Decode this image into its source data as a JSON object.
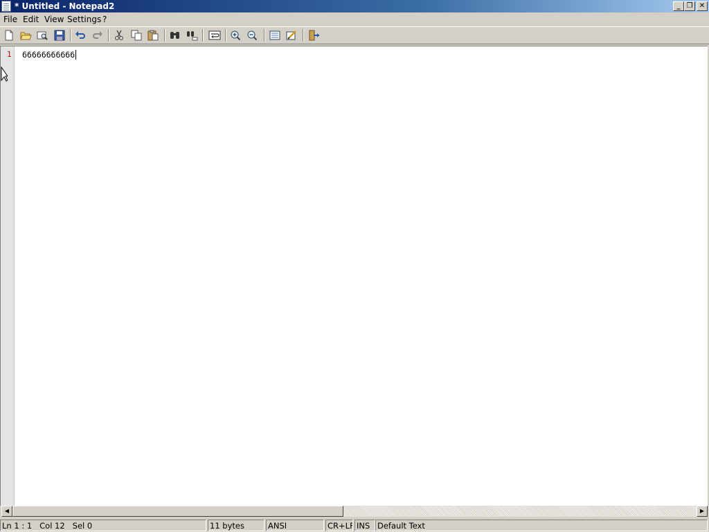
{
  "window": {
    "title": "* Untitled - Notepad2",
    "minimize_glyph": "_",
    "restore_glyph": "❐",
    "close_glyph": "✕"
  },
  "menu": {
    "items": [
      "File",
      "Edit",
      "View",
      "Settings",
      "?"
    ]
  },
  "toolbar": {
    "buttons": [
      "new-icon",
      "open-icon",
      "browse-icon",
      "save-icon",
      "undo-icon",
      "redo-icon",
      "cut-icon",
      "copy-icon",
      "paste-icon",
      "find-icon",
      "replace-icon",
      "word-wrap-icon",
      "zoom-in-icon",
      "zoom-out-icon",
      "select-scheme-icon",
      "customize-scheme-icon",
      "exit-icon"
    ]
  },
  "editor": {
    "lines": [
      {
        "number": "1",
        "text": "66666666666"
      }
    ]
  },
  "scrollbar": {
    "left_arrow": "◀",
    "right_arrow": "▶"
  },
  "status": {
    "position": "Ln 1 : 1   Col 12   Sel 0",
    "size": "11 bytes",
    "encoding": "ANSI",
    "line_endings": "CR+LF",
    "mode": "INS",
    "scheme": "Default Text"
  },
  "colors": {
    "title_gradient_start": "#0a246a",
    "title_gradient_end": "#a6caf0",
    "line_number": "#c00000",
    "chrome": "#d4d0c8"
  }
}
